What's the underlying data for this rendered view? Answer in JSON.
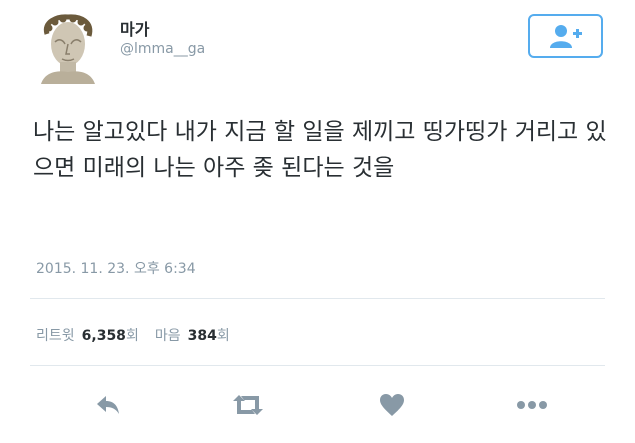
{
  "user": {
    "display_name": "마가",
    "handle": "@lmma__ga",
    "avatar_icon": "statue-bust-avatar"
  },
  "follow_button": {
    "icon": "follow-user-plus-icon"
  },
  "tweet": {
    "text": "나는 알고있다 내가 지금 할 일을 제끼고 띵가띵가 거리고 있으면 미래의 나는 아주 좆 된다는 것을",
    "timestamp": "2015. 11. 23. 오후 6:34"
  },
  "stats": {
    "retweets_label": "리트윗",
    "retweets_count": "6,358",
    "retweets_unit": "회",
    "likes_label": "마음",
    "likes_count": "384",
    "likes_unit": "회"
  },
  "actions": {
    "reply_icon": "reply-icon",
    "retweet_icon": "retweet-icon",
    "like_icon": "heart-icon",
    "more_icon": "more-dots-icon"
  },
  "colors": {
    "accent": "#55acee",
    "text": "#292f33",
    "muted": "#8899a6",
    "divider": "#e1e8ed"
  }
}
